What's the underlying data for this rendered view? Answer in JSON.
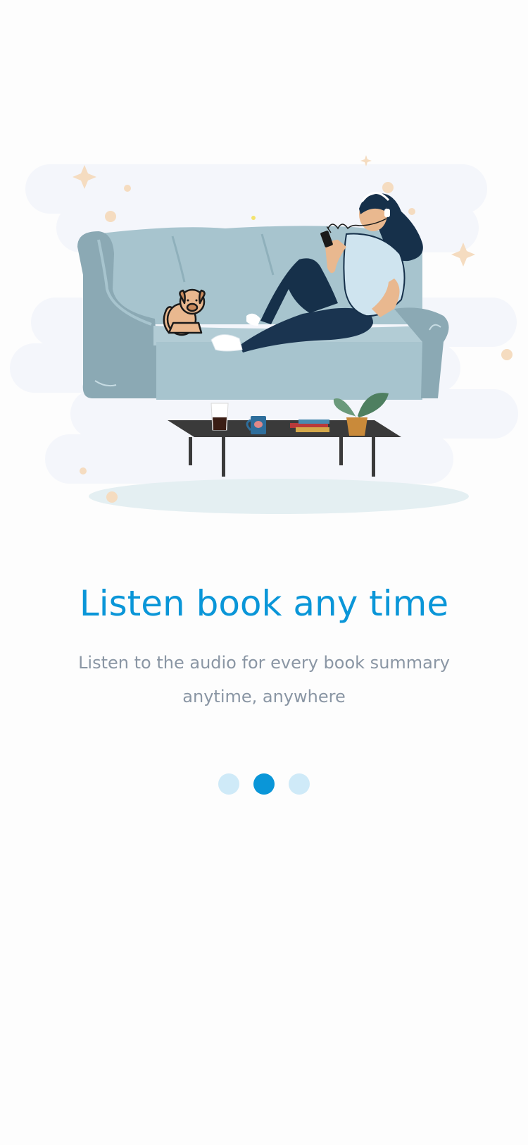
{
  "onboarding": {
    "title": "Listen book any time",
    "subtitle": "Listen to the audio for every book summary anytime, anywhere",
    "pagination": {
      "total": 3,
      "current": 2
    }
  },
  "colors": {
    "accent": "#0a96d8",
    "dot_inactive": "#cfeaf8",
    "subtitle": "#8a96a4",
    "sofa": "#a7c4ce",
    "background": "#fdfdfd"
  },
  "icons": {
    "illustration": "woman-listening-on-sofa-illustration"
  }
}
